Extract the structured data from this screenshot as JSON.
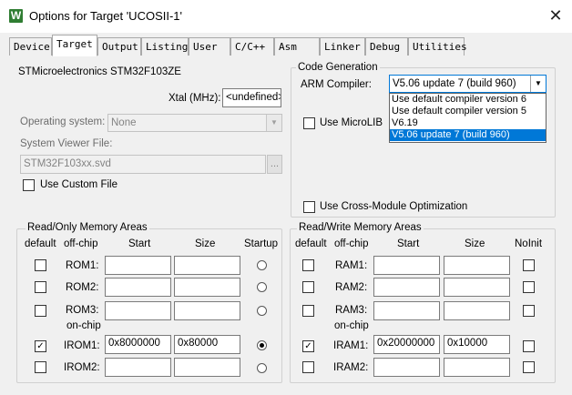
{
  "window": {
    "title": "Options for Target 'UCOSII-1'",
    "icon_letter": "W"
  },
  "tabs": [
    {
      "label": "Device",
      "active": false
    },
    {
      "label": "Target",
      "active": true
    },
    {
      "label": "Output",
      "active": false
    },
    {
      "label": "Listing",
      "active": false
    },
    {
      "label": "User",
      "active": false
    },
    {
      "label": "C/C++",
      "active": false
    },
    {
      "label": "Asm",
      "active": false
    },
    {
      "label": "Linker",
      "active": false
    },
    {
      "label": "Debug",
      "active": false
    },
    {
      "label": "Utilities",
      "active": false
    }
  ],
  "target": {
    "device_name": "STMicroelectronics STM32F103ZE",
    "xtal_label": "Xtal (MHz):",
    "xtal_value": "<undefined>",
    "os_label": "Operating system:",
    "os_value": "None",
    "svf_label": "System Viewer File:",
    "svf_value": "STM32F103xx.svd",
    "svf_browse": "...",
    "use_custom_file": "Use Custom File"
  },
  "code_generation": {
    "title": "Code Generation",
    "compiler_label": "ARM Compiler:",
    "compiler_value": "V5.06 update 7 (build 960)",
    "compiler_options": [
      "Use default compiler version 6",
      "Use default compiler version 5",
      "V6.19",
      "V5.06 update 7 (build 960)"
    ],
    "selected_option_index": 3,
    "use_microlib": "Use MicroLIB",
    "cross_module": "Use Cross-Module Optimization"
  },
  "rom_areas": {
    "title": "Read/Only Memory Areas",
    "headers": {
      "default": "default",
      "offchip": "off-chip",
      "start": "Start",
      "size": "Size",
      "startup": "Startup"
    },
    "onchip_label": "on-chip",
    "rows": [
      {
        "name": "ROM1:",
        "default": false,
        "start": "",
        "size": "",
        "startup": false
      },
      {
        "name": "ROM2:",
        "default": false,
        "start": "",
        "size": "",
        "startup": false
      },
      {
        "name": "ROM3:",
        "default": false,
        "start": "",
        "size": "",
        "startup": false
      },
      {
        "name": "IROM1:",
        "default": true,
        "start": "0x8000000",
        "size": "0x80000",
        "startup": true
      },
      {
        "name": "IROM2:",
        "default": false,
        "start": "",
        "size": "",
        "startup": false
      }
    ]
  },
  "ram_areas": {
    "title": "Read/Write Memory Areas",
    "headers": {
      "default": "default",
      "offchip": "off-chip",
      "start": "Start",
      "size": "Size",
      "noinit": "NoInit"
    },
    "onchip_label": "on-chip",
    "rows": [
      {
        "name": "RAM1:",
        "default": false,
        "start": "",
        "size": "",
        "noinit": false
      },
      {
        "name": "RAM2:",
        "default": false,
        "start": "",
        "size": "",
        "noinit": false
      },
      {
        "name": "RAM3:",
        "default": false,
        "start": "",
        "size": "",
        "noinit": false
      },
      {
        "name": "IRAM1:",
        "default": true,
        "start": "0x20000000",
        "size": "0x10000",
        "noinit": false
      },
      {
        "name": "IRAM2:",
        "default": false,
        "start": "",
        "size": "",
        "noinit": false
      }
    ]
  }
}
